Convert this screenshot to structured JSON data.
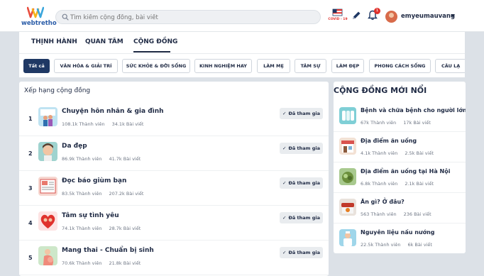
{
  "header": {
    "logo_text": "webtretho",
    "search_placeholder": "Tìm kiếm cộng đồng, bài viết",
    "username": "emyeumauvang",
    "icons": [
      "search-icon",
      "covid-badge-icon",
      "pencil-icon",
      "bell-icon",
      "chevron-down-icon"
    ],
    "covid_badge_text": "COVID - 19",
    "bell_count": "1"
  },
  "tabs": [
    "THỊNH HÀNH",
    "QUAN TÂM",
    "CỘNG ĐỒNG"
  ],
  "active_tab": "CỘNG ĐỒNG",
  "categories": [
    "Tất cả",
    "VĂN HÓA & GIẢI TRÍ",
    "SỨC KHỎE & ĐỜI SỐNG",
    "KINH NGHIỆM HAY",
    "LÀM MẸ",
    "TÂM SỰ",
    "LÀM ĐẸP",
    "PHONG CÁCH SỐNG",
    "CÂU LẠ"
  ],
  "ranking": {
    "title": "Xếp hạng cộng đồng",
    "join_label": "Đã tham gia",
    "items": [
      {
        "rank": "1",
        "name": "Chuyện hôn nhân & gia đình",
        "members": "108.1k Thành viên",
        "posts": "34.1k Bài viết"
      },
      {
        "rank": "2",
        "name": "Da đẹp",
        "members": "86.9k Thành viên",
        "posts": "41.7k Bài viết"
      },
      {
        "rank": "3",
        "name": "Đọc báo giùm bạn",
        "members": "83.5k Thành viên",
        "posts": "207.2k Bài viết"
      },
      {
        "rank": "4",
        "name": "Tâm sự tình yêu",
        "members": "74.1k Thành viên",
        "posts": "28.7k Bài viết"
      },
      {
        "rank": "5",
        "name": "Mang thai - Chuẩn bị sinh",
        "members": "70.6k Thành viên",
        "posts": "21.8k Bài viết"
      }
    ]
  },
  "new_communities": {
    "title": "CỘNG ĐỒNG MỚI NỔI",
    "items": [
      {
        "name": "Bệnh và chữa bệnh cho người lớn",
        "members": "67k Thành viên",
        "posts": "17k Bài viết"
      },
      {
        "name": "Địa điểm ăn uống",
        "members": "4.1k Thành viên",
        "posts": "2.5k Bài viết"
      },
      {
        "name": "Địa điểm ăn uống tại Hà Nội",
        "members": "6.8k Thành viên",
        "posts": "2.1k Bài viết"
      },
      {
        "name": "Ăn gì? Ở đâu?",
        "members": "563 Thành viên",
        "posts": "236 Bài viết"
      },
      {
        "name": "Nguyên liệu nấu nướng",
        "members": "22.5k Thành viên",
        "posts": "6k Bài viết"
      }
    ]
  },
  "colors": {
    "primary": "#1f3864",
    "background": "#dce1e7",
    "bell": "#e0322d"
  }
}
